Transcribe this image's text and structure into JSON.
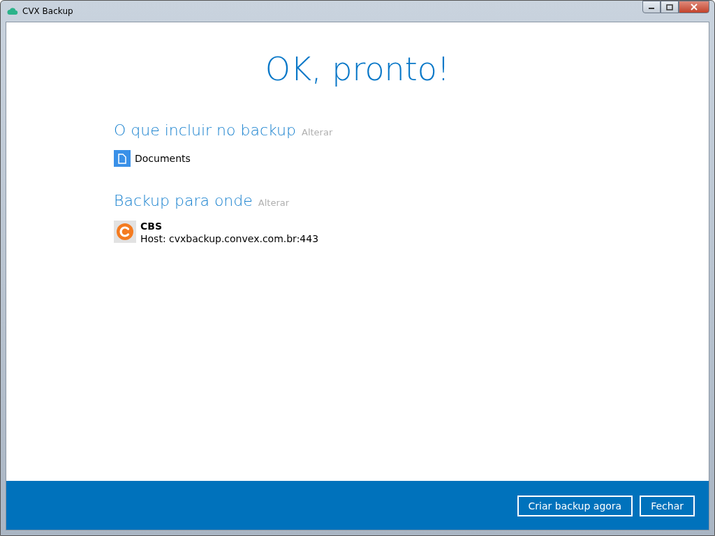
{
  "window": {
    "title": "CVX Backup"
  },
  "heading": "OK, pronto!",
  "sections": [
    {
      "title": "O que incluir no backup",
      "action": "Alterar",
      "items": [
        {
          "kind": "document",
          "name": "Documents"
        }
      ]
    },
    {
      "title": "Backup para onde",
      "action": "Alterar",
      "items": [
        {
          "kind": "server",
          "name": "CBS",
          "detail": "Host: cvxbackup.convex.com.br:443"
        }
      ]
    }
  ],
  "buttons": [
    "Criar backup agora",
    "Fechar"
  ]
}
